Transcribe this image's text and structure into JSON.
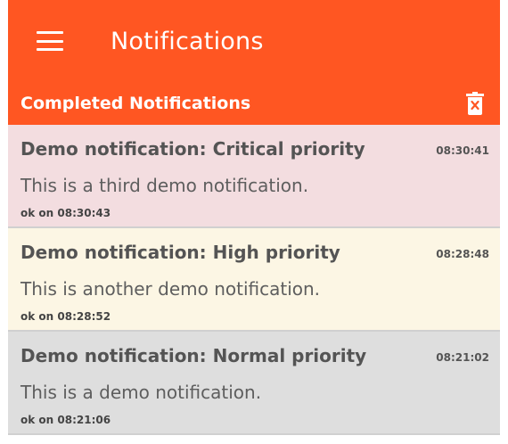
{
  "toolbar": {
    "title": "Notifications",
    "menu_icon": "hamburger-menu-icon"
  },
  "section": {
    "title": "Completed Notifications",
    "delete_icon": "trash-delete-icon"
  },
  "notifications": [
    {
      "subject": "Demo notification: Critical priority",
      "time": "08:30:41",
      "body": "This is a third demo notification.",
      "ack": "ok on 08:30:43",
      "color": "#f3dde0"
    },
    {
      "subject": "Demo notification: High priority",
      "time": "08:28:48",
      "body": "This is another demo notification.",
      "ack": "ok on 08:28:52",
      "color": "#fcf6e4"
    },
    {
      "subject": "Demo notification: Normal priority",
      "time": "08:21:02",
      "body": "This is a demo notification.",
      "ack": "ok on 08:21:06",
      "color": "#dedede"
    }
  ],
  "colors": {
    "accent": "#ff5622"
  }
}
